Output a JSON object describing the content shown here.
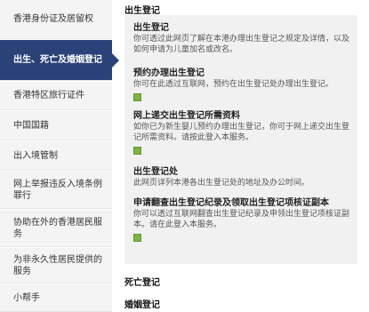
{
  "sidebar": {
    "items": [
      {
        "label": "香港身份证及居留权",
        "active": false
      },
      {
        "label": "出生、死亡及婚姻登记",
        "active": true
      },
      {
        "label": "香港特区旅行证件",
        "active": false
      },
      {
        "label": "中国国籍",
        "active": false
      },
      {
        "label": "出入境管制",
        "active": false
      },
      {
        "label": "网上举报违反入境条例罪行",
        "active": false
      },
      {
        "label": "协助在外的香港居民服务",
        "active": false
      },
      {
        "label": "为非永久性居民提供的服务",
        "active": false
      },
      {
        "label": "小帮手",
        "active": false
      }
    ]
  },
  "content": {
    "section1_title": "出生登记",
    "entries": [
      {
        "title": "出生登记",
        "desc": "你可透过此网页了解在本港办理出生登记之规定及详情，以及如何申请为儿童加名或改名。",
        "has_icon": false
      },
      {
        "title": "预约办理出生登记",
        "desc": "你可在此透过互联网，预约在出生登记处办理出生登记。",
        "has_icon": true
      },
      {
        "title": "网上递交出生登记所需资料",
        "desc": "如你已为新生婴儿预约办理出生登记，你可于网上递交出生登记所需资料。请按此登入本服务。",
        "has_icon": true
      },
      {
        "title": "出生登记处",
        "desc": "此网页详列本港各出生登记处的地址及办公时间。",
        "has_icon": false
      },
      {
        "title": "申请翻查出生登记纪录及领取出生登记项核证副本",
        "desc": "你可以透过互联网翻查出生登记纪录及申领出生登记项核证副本。请在此登入本服务。",
        "has_icon": true
      }
    ],
    "section2_title": "死亡登记",
    "section3_title": "婚姻登记"
  },
  "colors": {
    "active_bg": "#2b4279",
    "inactive_bg": "#f4f4f4",
    "panel_bg": "#f1f1f1",
    "icon_green": "#7cb342"
  }
}
